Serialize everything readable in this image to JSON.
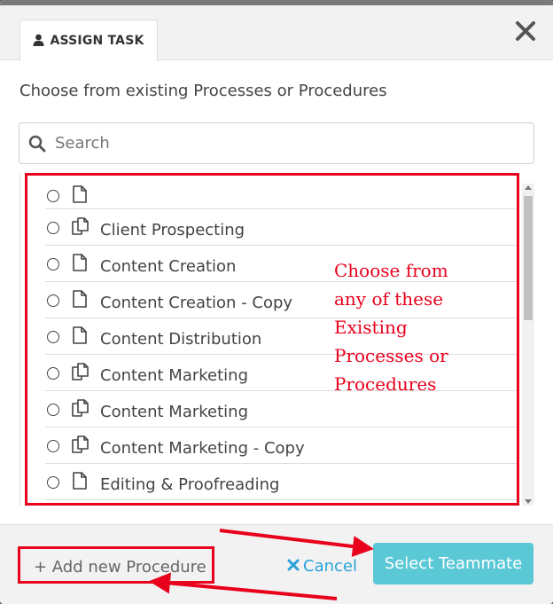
{
  "header": {
    "tab_label": "ASSIGN TASK"
  },
  "instruction": "Choose from existing Processes or Procedures",
  "search": {
    "placeholder": "Search",
    "value": ""
  },
  "items": [
    {
      "label": "",
      "icon": "document-icon"
    },
    {
      "label": "Client Prospecting",
      "icon": "copy-icon"
    },
    {
      "label": "Content Creation",
      "icon": "document-icon"
    },
    {
      "label": "Content Creation - Copy",
      "icon": "document-icon"
    },
    {
      "label": "Content Distribution",
      "icon": "document-icon"
    },
    {
      "label": "Content Marketing",
      "icon": "copy-icon"
    },
    {
      "label": "Content Marketing",
      "icon": "copy-icon"
    },
    {
      "label": "Content Marketing - Copy",
      "icon": "copy-icon"
    },
    {
      "label": "Editing & Proofreading",
      "icon": "document-icon"
    }
  ],
  "annotation": {
    "lines": [
      "Choose from",
      "any of these",
      "Existing",
      "Processes or",
      "Procedures"
    ]
  },
  "footer": {
    "add_label": "+ Add new Procedure",
    "cancel_label": "Cancel",
    "select_label": "Select Teammate"
  },
  "colors": {
    "annotation_red": "#e8001c",
    "accent": "#5bc8d6",
    "link": "#2aa3d8"
  }
}
